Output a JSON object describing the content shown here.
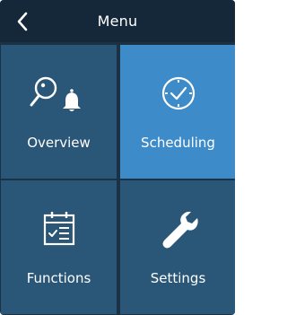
{
  "header": {
    "title": "Menu",
    "back_icon": "chevron-left-icon"
  },
  "tiles": [
    {
      "label": "Overview",
      "icon": "search-bell-icon",
      "active": false
    },
    {
      "label": "Scheduling",
      "icon": "clock-icon",
      "active": true
    },
    {
      "label": "Functions",
      "icon": "calendar-icon",
      "active": false
    },
    {
      "label": "Settings",
      "icon": "wrench-icon",
      "active": false
    }
  ],
  "colors": {
    "header_bg": "#14283a",
    "tile_bg": "#2a5677",
    "tile_active_bg": "#3d8bc8",
    "text": "#ffffff"
  }
}
